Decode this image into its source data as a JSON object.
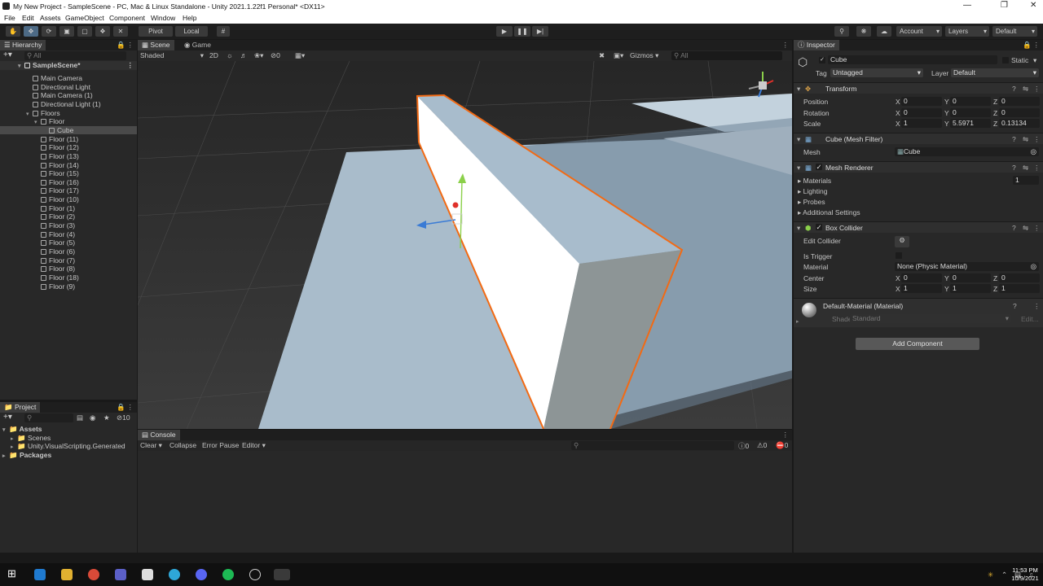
{
  "window": {
    "title": "My New Project - SampleScene - PC, Mac & Linux Standalone - Unity 2021.1.22f1 Personal* <DX11>"
  },
  "menu": [
    "File",
    "Edit",
    "Assets",
    "GameObject",
    "Component",
    "Window",
    "Help"
  ],
  "toolbar": {
    "pivot": "Pivot",
    "local": "Local",
    "account": "Account",
    "layers": "Layers",
    "layout": "Default"
  },
  "hierarchy": {
    "tab": "Hierarchy",
    "search_placeholder": "All",
    "scene": "SampleScene*",
    "items": [
      {
        "label": "Main Camera",
        "indent": 1
      },
      {
        "label": "Directional Light",
        "indent": 1
      },
      {
        "label": "Main Camera (1)",
        "indent": 1
      },
      {
        "label": "Directional Light (1)",
        "indent": 1
      },
      {
        "label": "Floors",
        "indent": 1,
        "fold": true
      },
      {
        "label": "Floor",
        "indent": 2,
        "fold": true
      },
      {
        "label": "Cube",
        "indent": 3,
        "selected": true
      },
      {
        "label": "Floor (11)",
        "indent": 2
      },
      {
        "label": "Floor (12)",
        "indent": 2
      },
      {
        "label": "Floor (13)",
        "indent": 2
      },
      {
        "label": "Floor (14)",
        "indent": 2
      },
      {
        "label": "Floor (15)",
        "indent": 2
      },
      {
        "label": "Floor (16)",
        "indent": 2
      },
      {
        "label": "Floor (17)",
        "indent": 2
      },
      {
        "label": "Floor (10)",
        "indent": 2
      },
      {
        "label": "Floor (1)",
        "indent": 2
      },
      {
        "label": "Floor (2)",
        "indent": 2
      },
      {
        "label": "Floor (3)",
        "indent": 2
      },
      {
        "label": "Floor (4)",
        "indent": 2
      },
      {
        "label": "Floor (5)",
        "indent": 2
      },
      {
        "label": "Floor (6)",
        "indent": 2
      },
      {
        "label": "Floor (7)",
        "indent": 2
      },
      {
        "label": "Floor (8)",
        "indent": 2
      },
      {
        "label": "Floor (18)",
        "indent": 2
      },
      {
        "label": "Floor (9)",
        "indent": 2
      }
    ]
  },
  "scene_view": {
    "tabs": [
      "Scene",
      "Game"
    ],
    "shading": "Shaded",
    "mode_2d": "2D",
    "hidden_count": "0",
    "gizmos": "Gizmos",
    "search_placeholder": "All"
  },
  "project": {
    "tab": "Project",
    "badge": "10",
    "tree": [
      {
        "label": "Assets",
        "indent": 0,
        "bold": true
      },
      {
        "label": "Scenes",
        "indent": 1
      },
      {
        "label": "Unity.VisualScripting.Generated",
        "indent": 1
      },
      {
        "label": "Packages",
        "indent": 0,
        "bold": true
      }
    ]
  },
  "console": {
    "tab": "Console",
    "buttons": [
      "Clear",
      "Collapse",
      "Error Pause",
      "Editor"
    ],
    "counts": {
      "info": "0",
      "warn": "0",
      "error": "0"
    }
  },
  "inspector": {
    "tab": "Inspector",
    "object_name": "Cube",
    "static_label": "Static",
    "tag_label": "Tag",
    "tag": "Untagged",
    "layer_label": "Layer",
    "layer": "Default",
    "transform": {
      "title": "Transform",
      "rows": [
        {
          "label": "Position",
          "x": "0",
          "y": "0",
          "z": "0"
        },
        {
          "label": "Rotation",
          "x": "0",
          "y": "0",
          "z": "0"
        },
        {
          "label": "Scale",
          "x": "1",
          "y": "5.5971",
          "z": "0.13134"
        }
      ]
    },
    "mesh_filter": {
      "title": "Cube (Mesh Filter)",
      "mesh_label": "Mesh",
      "mesh": "Cube"
    },
    "mesh_renderer": {
      "title": "Mesh Renderer",
      "materials": "Materials",
      "materials_count": "1",
      "lighting": "Lighting",
      "probes": "Probes",
      "additional": "Additional Settings"
    },
    "box_collider": {
      "title": "Box Collider",
      "edit_collider": "Edit Collider",
      "is_trigger": "Is Trigger",
      "material_label": "Material",
      "material": "None (Physic Material)",
      "center": {
        "label": "Center",
        "x": "0",
        "y": "0",
        "z": "0"
      },
      "size": {
        "label": "Size",
        "x": "1",
        "y": "1",
        "z": "1"
      }
    },
    "material": {
      "title": "Default-Material (Material)",
      "shader_label": "Shader",
      "shader": "Standard",
      "edit": "Edit..."
    },
    "add_component": "Add Component"
  },
  "taskbar": {
    "time": "11:53 PM",
    "date": "10/9/2021"
  }
}
